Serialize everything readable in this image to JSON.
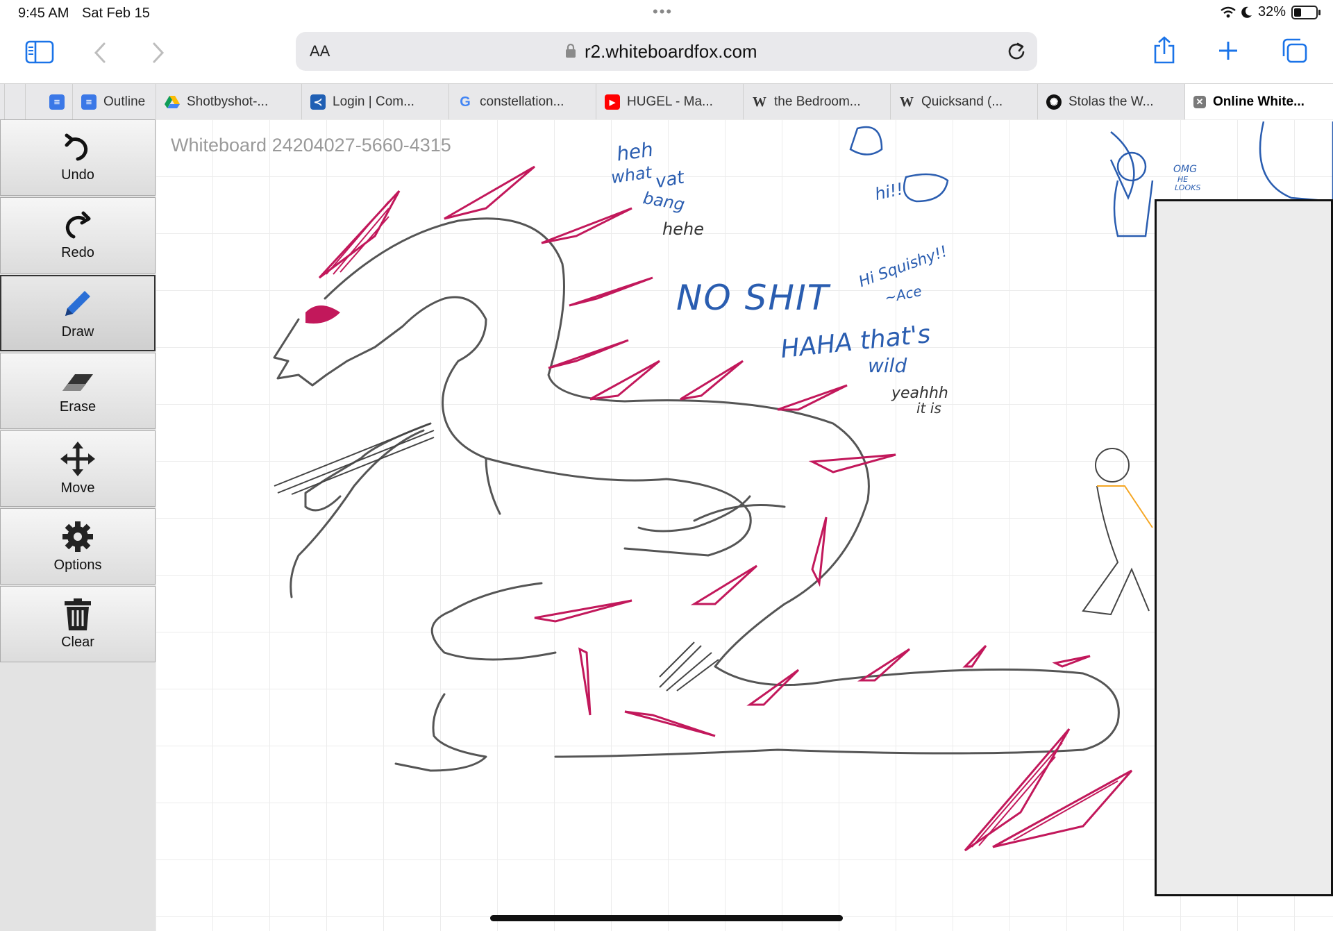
{
  "status_bar": {
    "time": "9:45 AM",
    "date": "Sat Feb 15",
    "battery": "32%",
    "battery_level": 0.32
  },
  "browser": {
    "text_size_label": "AA",
    "url": "r2.whiteboardfox.com",
    "icons": [
      "sidebar-icon",
      "back-icon",
      "forward-icon",
      "lock-icon",
      "reload-icon",
      "share-icon",
      "new-tab-icon",
      "tabs-overview-icon"
    ],
    "tabs": [
      {
        "label": "Outline",
        "favicon": "docs"
      },
      {
        "label": "Shotbyshot-...",
        "favicon": "drive"
      },
      {
        "label": "Login | Com...",
        "favicon": "login"
      },
      {
        "label": "constellation...",
        "favicon": "google"
      },
      {
        "label": "HUGEL - Ma...",
        "favicon": "youtube"
      },
      {
        "label": "the Bedroom...",
        "favicon": "wikipedia"
      },
      {
        "label": "Quicksand (...",
        "favicon": "wikipedia"
      },
      {
        "label": "Stolas the W...",
        "favicon": "openai"
      },
      {
        "label": "Online White...",
        "favicon": "close",
        "active": true
      }
    ]
  },
  "tools": [
    {
      "label": "Undo",
      "icon": "undo-icon"
    },
    {
      "label": "Redo",
      "icon": "redo-icon"
    },
    {
      "label": "Draw",
      "icon": "pencil-icon",
      "active": true
    },
    {
      "label": "Erase",
      "icon": "eraser-icon"
    },
    {
      "label": "Move",
      "icon": "move-icon"
    },
    {
      "label": "Options",
      "icon": "gear-icon"
    },
    {
      "label": "Clear",
      "icon": "trash-icon"
    }
  ],
  "whiteboard": {
    "title": "Whiteboard 24204027-5660-4315",
    "handwritten_notes": [
      "heh",
      "what",
      "vat",
      "bang",
      "hehe",
      "hi!!",
      "NO SHIT",
      "HAHA that's",
      "wild",
      "yeahhh",
      "it is",
      "Hi Squishy!!",
      "~Ace",
      "OMG",
      "HE",
      "LOOKS"
    ]
  },
  "colors": {
    "accent_blue": "#1a73e8",
    "drawing_magenta": "#c2185b",
    "drawing_gray": "#555555",
    "note_blue": "#2a5db0"
  }
}
